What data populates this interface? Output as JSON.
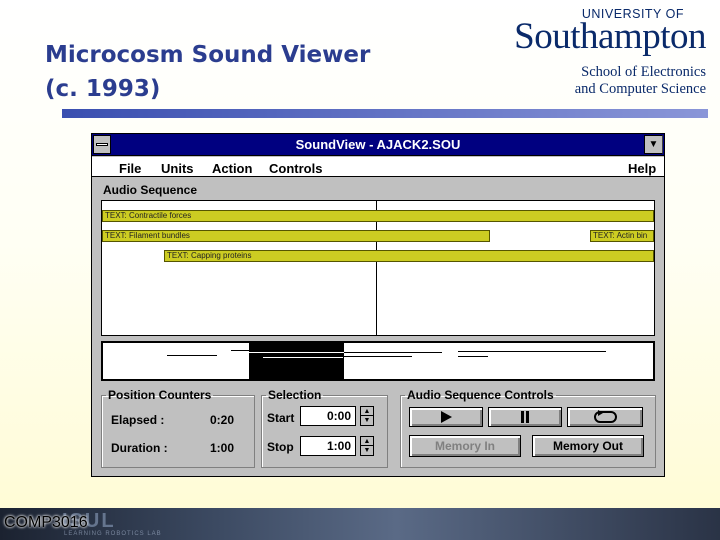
{
  "slide": {
    "title_line1": "Microcosm Sound Viewer",
    "title_line2": "(c. 1993)",
    "footer_code": "COMP3016",
    "footer_watermark": "ISUL",
    "footer_watermark_sub": "LEARNING ROBOTICS LAB"
  },
  "logo": {
    "university": "UNIVERSITY OF",
    "name": "Southampton",
    "school_line1": "School of Electronics",
    "school_line2": "and Computer Science",
    "color": "#0a2a6a"
  },
  "window": {
    "title": "SoundView - AJACK2.SOU",
    "minimize_icon": "down-triangle",
    "system_menu_icon": "control-menu"
  },
  "menu": {
    "file": "File",
    "units": "Units",
    "action": "Action",
    "controls": "Controls",
    "help": "Help"
  },
  "audio_sequence": {
    "label": "Audio Sequence",
    "tracks": [
      {
        "label": "TEXT: Contractile forces"
      },
      {
        "label": "TEXT: Filament bundles"
      },
      {
        "label": "TEXT: Actin bin"
      },
      {
        "label": "TEXT: Capping proteins"
      }
    ],
    "track_color": "#cccc22"
  },
  "position_counters": {
    "legend": "Position Counters",
    "elapsed_label": "Elapsed  :",
    "elapsed_value": "0:20",
    "duration_label": "Duration  :",
    "duration_value": "1:00"
  },
  "selection": {
    "legend": "Selection",
    "start_label": "Start",
    "start_value": "0:00",
    "stop_label": "Stop",
    "stop_value": "1:00"
  },
  "controls": {
    "legend": "Audio Sequence Controls",
    "play_icon": "play-icon",
    "pause_icon": "pause-icon",
    "loop_icon": "loop-icon",
    "memory_in": "Memory In",
    "memory_out": "Memory Out"
  }
}
